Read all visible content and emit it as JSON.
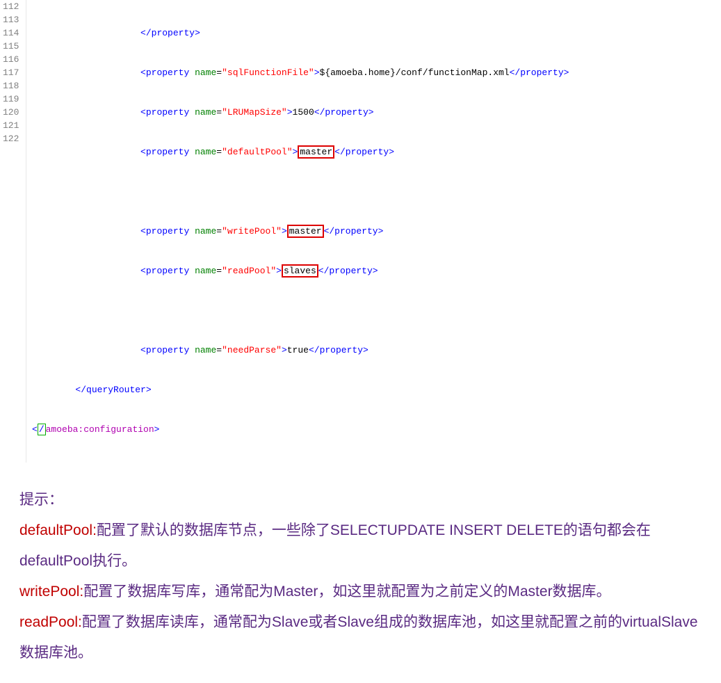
{
  "lines": {
    "n112": "112",
    "n113": "113",
    "n114": "114",
    "n115": "115",
    "n116": "116",
    "n117": "117",
    "n118": "118",
    "n119": "119",
    "n120": "120",
    "n121": "121",
    "n122": "122"
  },
  "code": {
    "indent_prop": "                    ",
    "indent_qr": "        ",
    "tag_property": "property",
    "tag_close_property": "/property",
    "a_name": "name",
    "eq": "=",
    "v_sqlFunctionFile": "\"sqlFunctionFile\"",
    "t_sqlFunctionFile": "${amoeba.home}/conf/functionMap.xml",
    "v_LRUMapSize": "\"LRUMapSize\"",
    "t_LRUMapSize": "1500",
    "v_defaultPool": "\"defaultPool\"",
    "t_defaultPool": "master",
    "v_writePool": "\"writePool\"",
    "t_writePool": "master",
    "v_readPool": "\"readPool\"",
    "t_readPool": "slaves",
    "v_needParse": "\"needParse\"",
    "t_needParse": "true",
    "tag_close_queryRouter": "/queryRouter",
    "lt": "<",
    "gt": ">",
    "caret_char": "/",
    "tag_amoeba_close": "amoeba:configuration"
  },
  "notes": {
    "title": "提示：",
    "p1_key": "defaultPool:",
    "p1_body": "配置了默认的数据库节点，一些除了SELECTUPDATE INSERT DELETE的语句都会在defaultPool执行。",
    "p2_key": "writePool:",
    "p2_body": "配置了数据库写库，通常配为Master，如这里就配置为之前定义的Master数据库。",
    "p3_key": "readPool:",
    "p3_body": "配置了数据库读库，通常配为Slave或者Slave组成的数据库池，如这里就配置之前的virtualSlave数据库池。"
  }
}
